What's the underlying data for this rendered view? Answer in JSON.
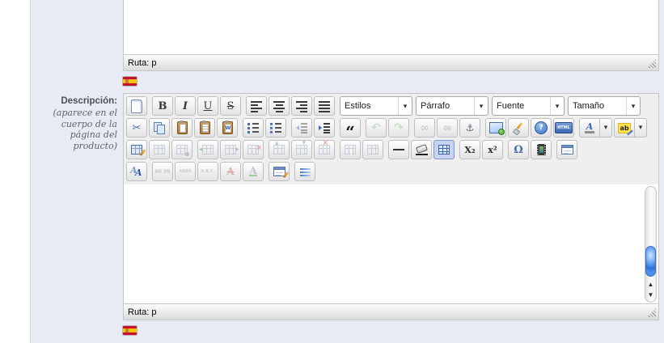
{
  "colors": {
    "panel_bg": "#e8ebf4",
    "toolbar_bg": "#efefef",
    "button_border": "#bfbfbf",
    "pressed_bg": "#c7d3f1",
    "pressed_border": "#8095c8",
    "scroll_thumb": "#3f87e5",
    "flag_red": "#c8102e",
    "flag_yellow": "#f7c500"
  },
  "description_field": {
    "label": "Descripción:",
    "note": "(aparece en el cuerpo de la página del producto)"
  },
  "top_editor": {
    "status_path": "Ruta: p",
    "language_flag": "es"
  },
  "main_editor": {
    "status_path": "Ruta: p",
    "language_flag": "es",
    "scrollbar": {
      "up_arrow": "▲",
      "down_arrow": "▼"
    },
    "toolbar": {
      "rows": [
        {
          "groups": [
            {
              "items": [
                {
                  "name": "new-document"
                }
              ]
            },
            {
              "items": [
                {
                  "name": "bold",
                  "glyph": "B"
                },
                {
                  "name": "italic",
                  "glyph": "I"
                },
                {
                  "name": "underline",
                  "glyph": "U"
                },
                {
                  "name": "strikethrough",
                  "glyph": "S"
                }
              ]
            },
            {
              "items": [
                {
                  "name": "align-left"
                },
                {
                  "name": "align-center"
                },
                {
                  "name": "align-right"
                },
                {
                  "name": "align-justify"
                }
              ]
            },
            {
              "items": [
                {
                  "type": "select",
                  "name": "styles",
                  "label": "Estilos"
                },
                {
                  "type": "select",
                  "name": "paragraph-format",
                  "label": "Párrafo"
                },
                {
                  "type": "select",
                  "name": "font-family",
                  "label": "Fuente"
                },
                {
                  "type": "select",
                  "name": "font-size",
                  "label": "Tamaño"
                }
              ]
            }
          ]
        },
        {
          "groups": [
            {
              "items": [
                {
                  "name": "cut",
                  "glyph": "✂"
                },
                {
                  "name": "copy"
                },
                {
                  "name": "paste"
                },
                {
                  "name": "paste-as-text"
                },
                {
                  "name": "paste-from-word"
                }
              ]
            },
            {
              "items": [
                {
                  "name": "unordered-list"
                },
                {
                  "name": "ordered-list"
                }
              ]
            },
            {
              "items": [
                {
                  "name": "outdent",
                  "state": "disabled"
                },
                {
                  "name": "indent"
                }
              ]
            },
            {
              "items": [
                {
                  "name": "blockquote",
                  "glyph": "“"
                }
              ]
            },
            {
              "items": [
                {
                  "name": "undo",
                  "glyph": "↶",
                  "state": "disabled"
                },
                {
                  "name": "redo",
                  "glyph": "↷",
                  "state": "disabled"
                }
              ]
            },
            {
              "items": [
                {
                  "name": "insert-link",
                  "glyph": "∞",
                  "state": "disabled"
                },
                {
                  "name": "remove-link",
                  "glyph": "∞",
                  "state": "disabled"
                },
                {
                  "name": "anchor",
                  "glyph": "⚓"
                }
              ]
            },
            {
              "items": [
                {
                  "name": "insert-image"
                },
                {
                  "name": "cleanup-code"
                },
                {
                  "name": "help",
                  "glyph": "?"
                },
                {
                  "name": "html-source",
                  "glyph": "HTML"
                }
              ]
            },
            {
              "items": [
                {
                  "type": "split",
                  "name": "text-color",
                  "glyph": "A"
                },
                {
                  "type": "split",
                  "name": "highlight-color",
                  "glyph": "ab"
                }
              ]
            }
          ]
        },
        {
          "groups": [
            {
              "items": [
                {
                  "name": "insert-table"
                },
                {
                  "name": "table-row-properties",
                  "state": "disabled"
                },
                {
                  "name": "table-cell-properties",
                  "state": "disabled"
                }
              ]
            },
            {
              "items": [
                {
                  "name": "insert-row-before",
                  "state": "disabled"
                },
                {
                  "name": "insert-row-after",
                  "state": "disabled"
                },
                {
                  "name": "delete-row",
                  "state": "disabled"
                }
              ]
            },
            {
              "items": [
                {
                  "name": "insert-column-before",
                  "state": "disabled"
                },
                {
                  "name": "insert-column-after",
                  "state": "disabled"
                },
                {
                  "name": "delete-column",
                  "state": "disabled"
                }
              ]
            },
            {
              "items": [
                {
                  "name": "split-cells",
                  "state": "disabled"
                },
                {
                  "name": "merge-cells",
                  "state": "disabled"
                }
              ]
            },
            {
              "items": [
                {
                  "name": "horizontal-rule"
                },
                {
                  "name": "remove-formatting"
                },
                {
                  "name": "toggle-guidelines",
                  "state": "pressed"
                }
              ]
            },
            {
              "items": [
                {
                  "name": "subscript",
                  "glyph": "X₂"
                },
                {
                  "name": "superscript",
                  "glyph": "x²"
                }
              ]
            },
            {
              "items": [
                {
                  "name": "special-character",
                  "glyph": "Ω"
                },
                {
                  "name": "insert-media"
                }
              ]
            },
            {
              "items": [
                {
                  "name": "insert-template"
                }
              ]
            }
          ]
        },
        {
          "groups": [
            {
              "items": [
                {
                  "name": "edit-css-style"
                }
              ]
            },
            {
              "items": [
                {
                  "name": "citation",
                  "glyph": "66 99",
                  "state": "disabled"
                },
                {
                  "name": "abbreviation",
                  "glyph": "ABBR",
                  "state": "disabled"
                },
                {
                  "name": "acronym",
                  "glyph": "A.B.C.",
                  "state": "disabled"
                },
                {
                  "name": "deletion",
                  "glyph": "A",
                  "state": "disabled"
                },
                {
                  "name": "insertion",
                  "glyph": "A",
                  "state": "disabled"
                }
              ]
            },
            {
              "items": [
                {
                  "name": "edit-attributes"
                }
              ]
            },
            {
              "items": [
                {
                  "name": "visual-characters"
                }
              ]
            }
          ]
        }
      ]
    }
  },
  "glyphs": {
    "dropdown_arrow": "▾"
  }
}
